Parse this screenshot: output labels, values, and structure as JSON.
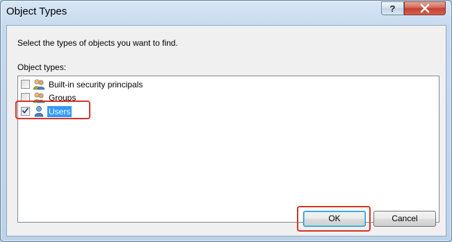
{
  "window": {
    "title": "Object Types",
    "help_label": "?",
    "close_label": "✕"
  },
  "dialog": {
    "instruction": "Select the types of objects you want to find.",
    "list_label": "Object types:",
    "items": [
      {
        "label": "Built-in security principals",
        "checked": false,
        "icon": "group-users-icon"
      },
      {
        "label": "Groups",
        "checked": false,
        "icon": "group-users-icon"
      },
      {
        "label": "Users",
        "checked": true,
        "selected": true,
        "icon": "user-icon"
      }
    ]
  },
  "buttons": {
    "ok_label": "OK",
    "cancel_label": "Cancel"
  },
  "colors": {
    "selection": "#3399ff",
    "annotation_highlight": "#d63227",
    "close_button": "#c4402f"
  }
}
